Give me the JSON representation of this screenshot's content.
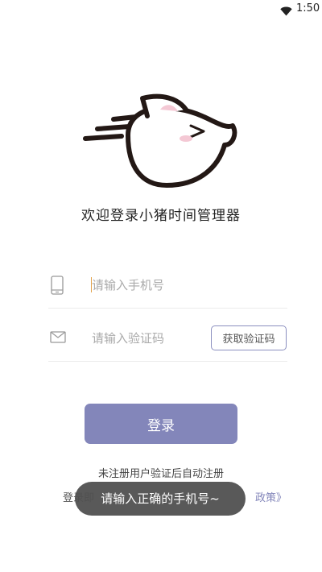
{
  "status_bar": {
    "time": "1:50",
    "wifi_icon": "wifi-icon"
  },
  "app": {
    "logo_icon": "running-pig-icon",
    "welcome_text": "欢迎登录小猪时间管理器"
  },
  "form": {
    "phone": {
      "icon": "phone-icon",
      "placeholder": "请输入手机号",
      "value": ""
    },
    "code": {
      "icon": "mail-icon",
      "placeholder": "请输入验证码",
      "value": "",
      "get_code_label": "获取验证码"
    },
    "login_label": "登录",
    "auto_register_text": "未注册用户验证后自动注册",
    "agreement_prefix": "登录即",
    "agreement_link": "政策》"
  },
  "toast": {
    "message": "请输入正确的手机号~"
  },
  "colors": {
    "accent": "#8386ba",
    "toast_bg": "#505050",
    "logo_stroke": "#231815",
    "ear_pink": "#f4c8d4"
  }
}
